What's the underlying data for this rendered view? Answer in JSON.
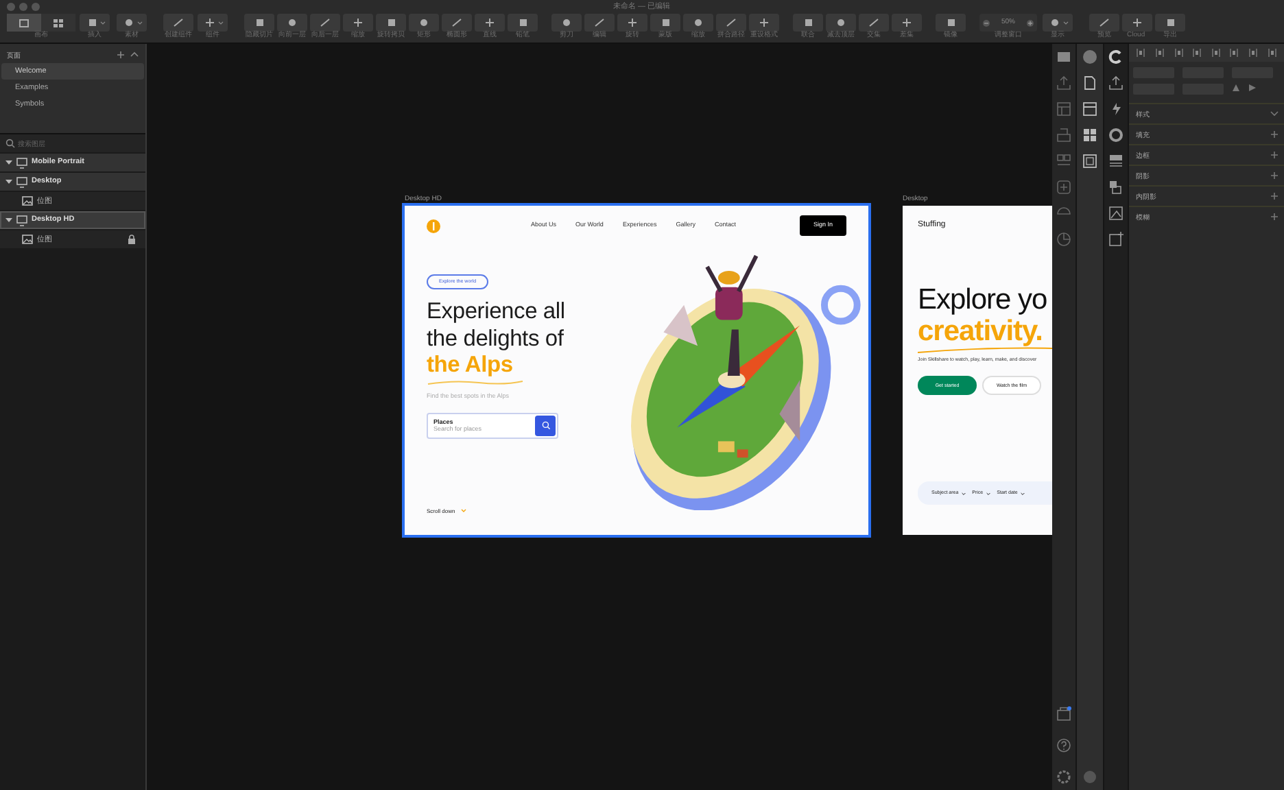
{
  "window": {
    "title": "未命名 — 已编辑"
  },
  "toolbar": {
    "groups": [
      [
        {
          "kind": "segmented",
          "label": "画布",
          "segments": [
            {
              "selected": true
            },
            {
              "selected": false
            }
          ]
        },
        {
          "kind": "menu",
          "label": "插入"
        },
        {
          "kind": "menu",
          "label": "素材"
        }
      ],
      [
        {
          "kind": "button",
          "label": "创建组件"
        },
        {
          "kind": "menu",
          "label": "组件"
        }
      ],
      [
        {
          "kind": "button",
          "label": "隐藏切片"
        },
        {
          "kind": "button",
          "label": "向前一层"
        },
        {
          "kind": "button",
          "label": "向后一层"
        },
        {
          "kind": "button",
          "label": "缩放"
        },
        {
          "kind": "button",
          "label": "旋转拷贝"
        },
        {
          "kind": "button",
          "label": "矩形"
        },
        {
          "kind": "button",
          "label": "椭圆形"
        },
        {
          "kind": "button",
          "label": "直线"
        },
        {
          "kind": "button",
          "label": "铅笔"
        }
      ],
      [
        {
          "kind": "button",
          "label": "剪刀"
        },
        {
          "kind": "button",
          "label": "编辑"
        },
        {
          "kind": "button",
          "label": "旋转"
        },
        {
          "kind": "button",
          "label": "蒙版"
        },
        {
          "kind": "button",
          "label": "缩放"
        },
        {
          "kind": "button",
          "label": "拼合路径"
        },
        {
          "kind": "button",
          "label": "重设格式"
        }
      ],
      [
        {
          "kind": "button",
          "label": "联合"
        },
        {
          "kind": "button",
          "label": "减去顶层"
        },
        {
          "kind": "button",
          "label": "交集"
        },
        {
          "kind": "button",
          "label": "差集"
        }
      ],
      [
        {
          "kind": "button",
          "label": "镜像"
        }
      ],
      [
        {
          "kind": "zoom",
          "label": "调整窗口",
          "value": "50%"
        },
        {
          "kind": "menu",
          "label": "显示"
        }
      ],
      [
        {
          "kind": "button",
          "label": "预览"
        },
        {
          "kind": "button",
          "label": "Cloud"
        },
        {
          "kind": "button",
          "label": "导出"
        }
      ]
    ]
  },
  "pages": {
    "title": "页面",
    "items": [
      {
        "label": "Welcome",
        "selected": true
      },
      {
        "label": "Examples",
        "selected": false
      },
      {
        "label": "Symbols",
        "selected": false
      }
    ]
  },
  "layers": {
    "search": {
      "placeholder": "搜索图层"
    },
    "items": [
      {
        "label": "Mobile Portrait",
        "kind": "artboard",
        "expanded": true,
        "selected": false,
        "locked": false
      },
      {
        "label": "Desktop",
        "kind": "artboard",
        "expanded": true,
        "selected": false,
        "locked": false,
        "children": [
          {
            "label": "位图",
            "kind": "bitmap",
            "selected": false,
            "locked": false
          }
        ]
      },
      {
        "label": "Desktop HD",
        "kind": "artboard",
        "expanded": true,
        "selected": true,
        "locked": false,
        "children": [
          {
            "label": "位图",
            "kind": "bitmap",
            "selected": false,
            "locked": true
          }
        ]
      }
    ]
  },
  "artboards": [
    {
      "title": "Desktop HD",
      "kind": "alps",
      "selected": true,
      "nav": [
        "About Us",
        "Our World",
        "Experiences",
        "Gallery",
        "Contact"
      ],
      "cta": "Sign In",
      "pill": "Explore the world",
      "headline": "Experience all the delights of",
      "highlight": "the Alps",
      "subtitle": "Find the best spots in the Alps",
      "search": {
        "label": "Places",
        "placeholder": "Search for places"
      },
      "scroll": "Scroll down"
    },
    {
      "title": "Desktop",
      "kind": "stuffing",
      "selected": false,
      "brand": "Stuffing",
      "headline": "Explore yo",
      "highlight": "creativity.",
      "subtitle": "Join Skillshare to watch, play, learn, make, and discover",
      "primary": "Get started",
      "secondary": "Watch the film",
      "filters": [
        "Subject area",
        "Price",
        "Start date"
      ]
    }
  ],
  "inspector": {
    "sections": [
      {
        "label": "样式",
        "kind": "collapse"
      },
      {
        "label": "填充",
        "kind": "add"
      },
      {
        "label": "边框",
        "kind": "add"
      },
      {
        "label": "阴影",
        "kind": "add"
      },
      {
        "label": "内阴影",
        "kind": "add"
      },
      {
        "label": "模糊",
        "kind": "add"
      }
    ]
  }
}
